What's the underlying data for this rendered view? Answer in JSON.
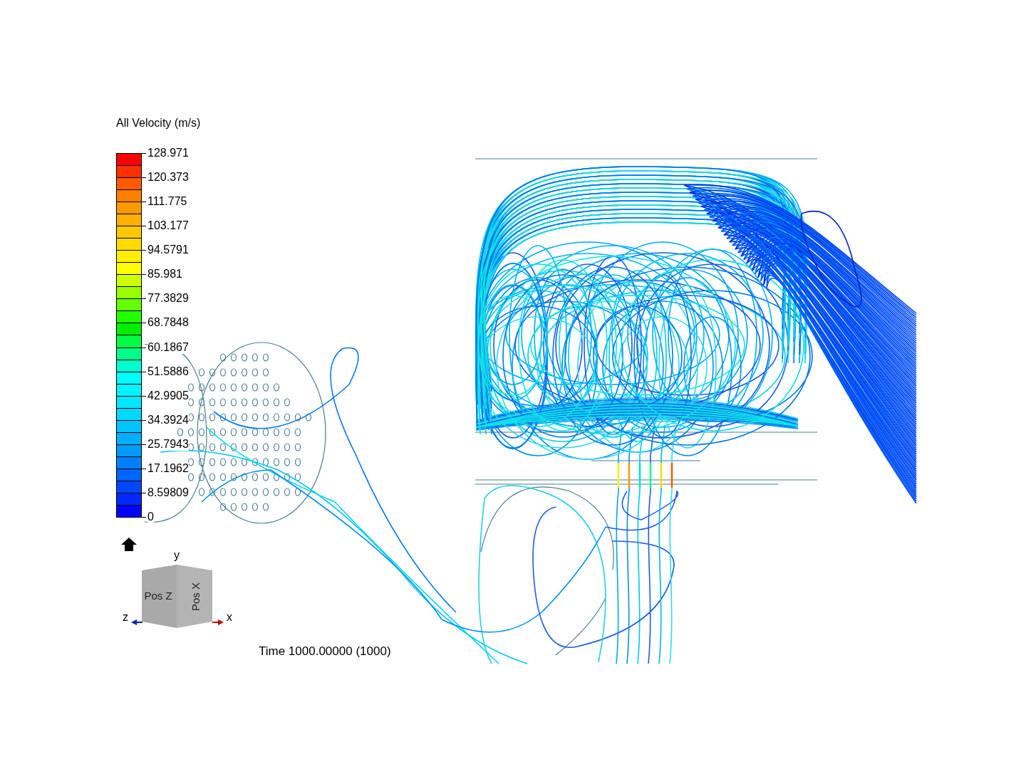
{
  "legend": {
    "title": "All Velocity (m/s)",
    "bands": [
      {
        "color": "#ff0000"
      },
      {
        "color": "#ff3000"
      },
      {
        "color": "#ff5a00"
      },
      {
        "color": "#ff7f00"
      },
      {
        "color": "#ff9900"
      },
      {
        "color": "#ffb000"
      },
      {
        "color": "#ffc800"
      },
      {
        "color": "#ffdc00"
      },
      {
        "color": "#ffee00"
      },
      {
        "color": "#ffff00"
      },
      {
        "color": "#ccff00"
      },
      {
        "color": "#99ff00"
      },
      {
        "color": "#66ff00"
      },
      {
        "color": "#22ff00"
      },
      {
        "color": "#00ee00"
      },
      {
        "color": "#00ff44"
      },
      {
        "color": "#00ff88"
      },
      {
        "color": "#00ffcc"
      },
      {
        "color": "#00ffff"
      },
      {
        "color": "#00f4ff"
      },
      {
        "color": "#00e8ff"
      },
      {
        "color": "#00d8ff"
      },
      {
        "color": "#00c4ff"
      },
      {
        "color": "#00b0ff"
      },
      {
        "color": "#009cff"
      },
      {
        "color": "#0080ff"
      },
      {
        "color": "#0064ff"
      },
      {
        "color": "#0048ff"
      },
      {
        "color": "#0028ff"
      },
      {
        "color": "#0000ff"
      }
    ],
    "ticks": [
      "128.971",
      "120.373",
      "111.775",
      "103.177",
      "94.5791",
      "85.981",
      "77.3829",
      "68.7848",
      "60.1867",
      "51.5886",
      "42.9905",
      "34.3924",
      "25.7943",
      "17.1962",
      "8.59809",
      "0"
    ]
  },
  "view_cube": {
    "front_label": "Pos Z",
    "side_label": "Pos X",
    "axes": [
      {
        "kind": "up",
        "label": "y"
      },
      {
        "kind": "left",
        "label": "z"
      },
      {
        "kind": "right",
        "label": "x"
      }
    ]
  },
  "time_label": "Time 1000.00000 (1000)"
}
